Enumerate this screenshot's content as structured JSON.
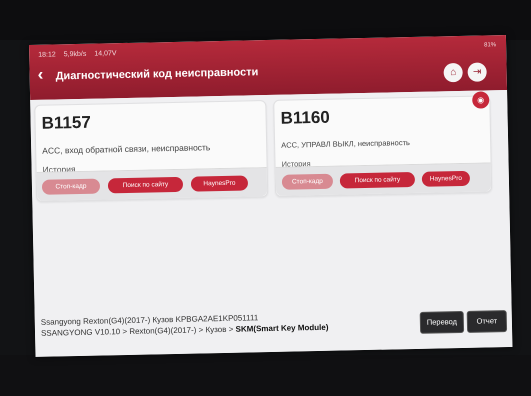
{
  "status_bar": {
    "time": "18:12",
    "net_speed": "5,9kb/s",
    "voltage": "14,07V",
    "battery": "81%"
  },
  "header": {
    "back_icon": "‹",
    "title": "Диагностический код неисправности",
    "home_icon": "⌂",
    "exit_icon": "⇥"
  },
  "cards": [
    {
      "code": "B1157",
      "description": "ACC, вход обратной связи, неисправность",
      "status": "История",
      "buttons": {
        "freeze": "Стоп-кадр",
        "search": "Поиск по сайту",
        "haynes": "HaynesPro"
      }
    },
    {
      "code": "B1160",
      "description": "ACC, УПРАВЛ ВЫКЛ, неисправность",
      "status": "История",
      "buttons": {
        "freeze": "Стоп-кадр",
        "search": "Поиск по сайту",
        "haynes": "HaynesPro"
      }
    }
  ],
  "footer": {
    "vehicle_line": "Ssangyong  Rexton(G4)(2017-) Кузов  KPBGA2AE1KP051111",
    "path_prefix": "SSANGYONG V10.10 > Rexton(G4)(2017-) > Кузов > ",
    "path_module": "SKM(Smart Key Module)",
    "translate_label": "Перевод",
    "report_label": "Отчет"
  }
}
